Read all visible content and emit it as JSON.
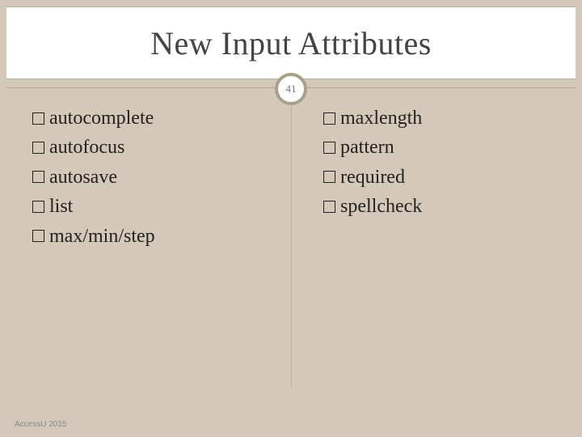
{
  "title": "New Input Attributes",
  "page_number": "41",
  "left_column": [
    "autocomplete",
    "autofocus",
    "autosave",
    "list",
    "max/min/step"
  ],
  "right_column": [
    "maxlength",
    "pattern",
    "required",
    "spellcheck"
  ],
  "footer": "AccessU 2015"
}
